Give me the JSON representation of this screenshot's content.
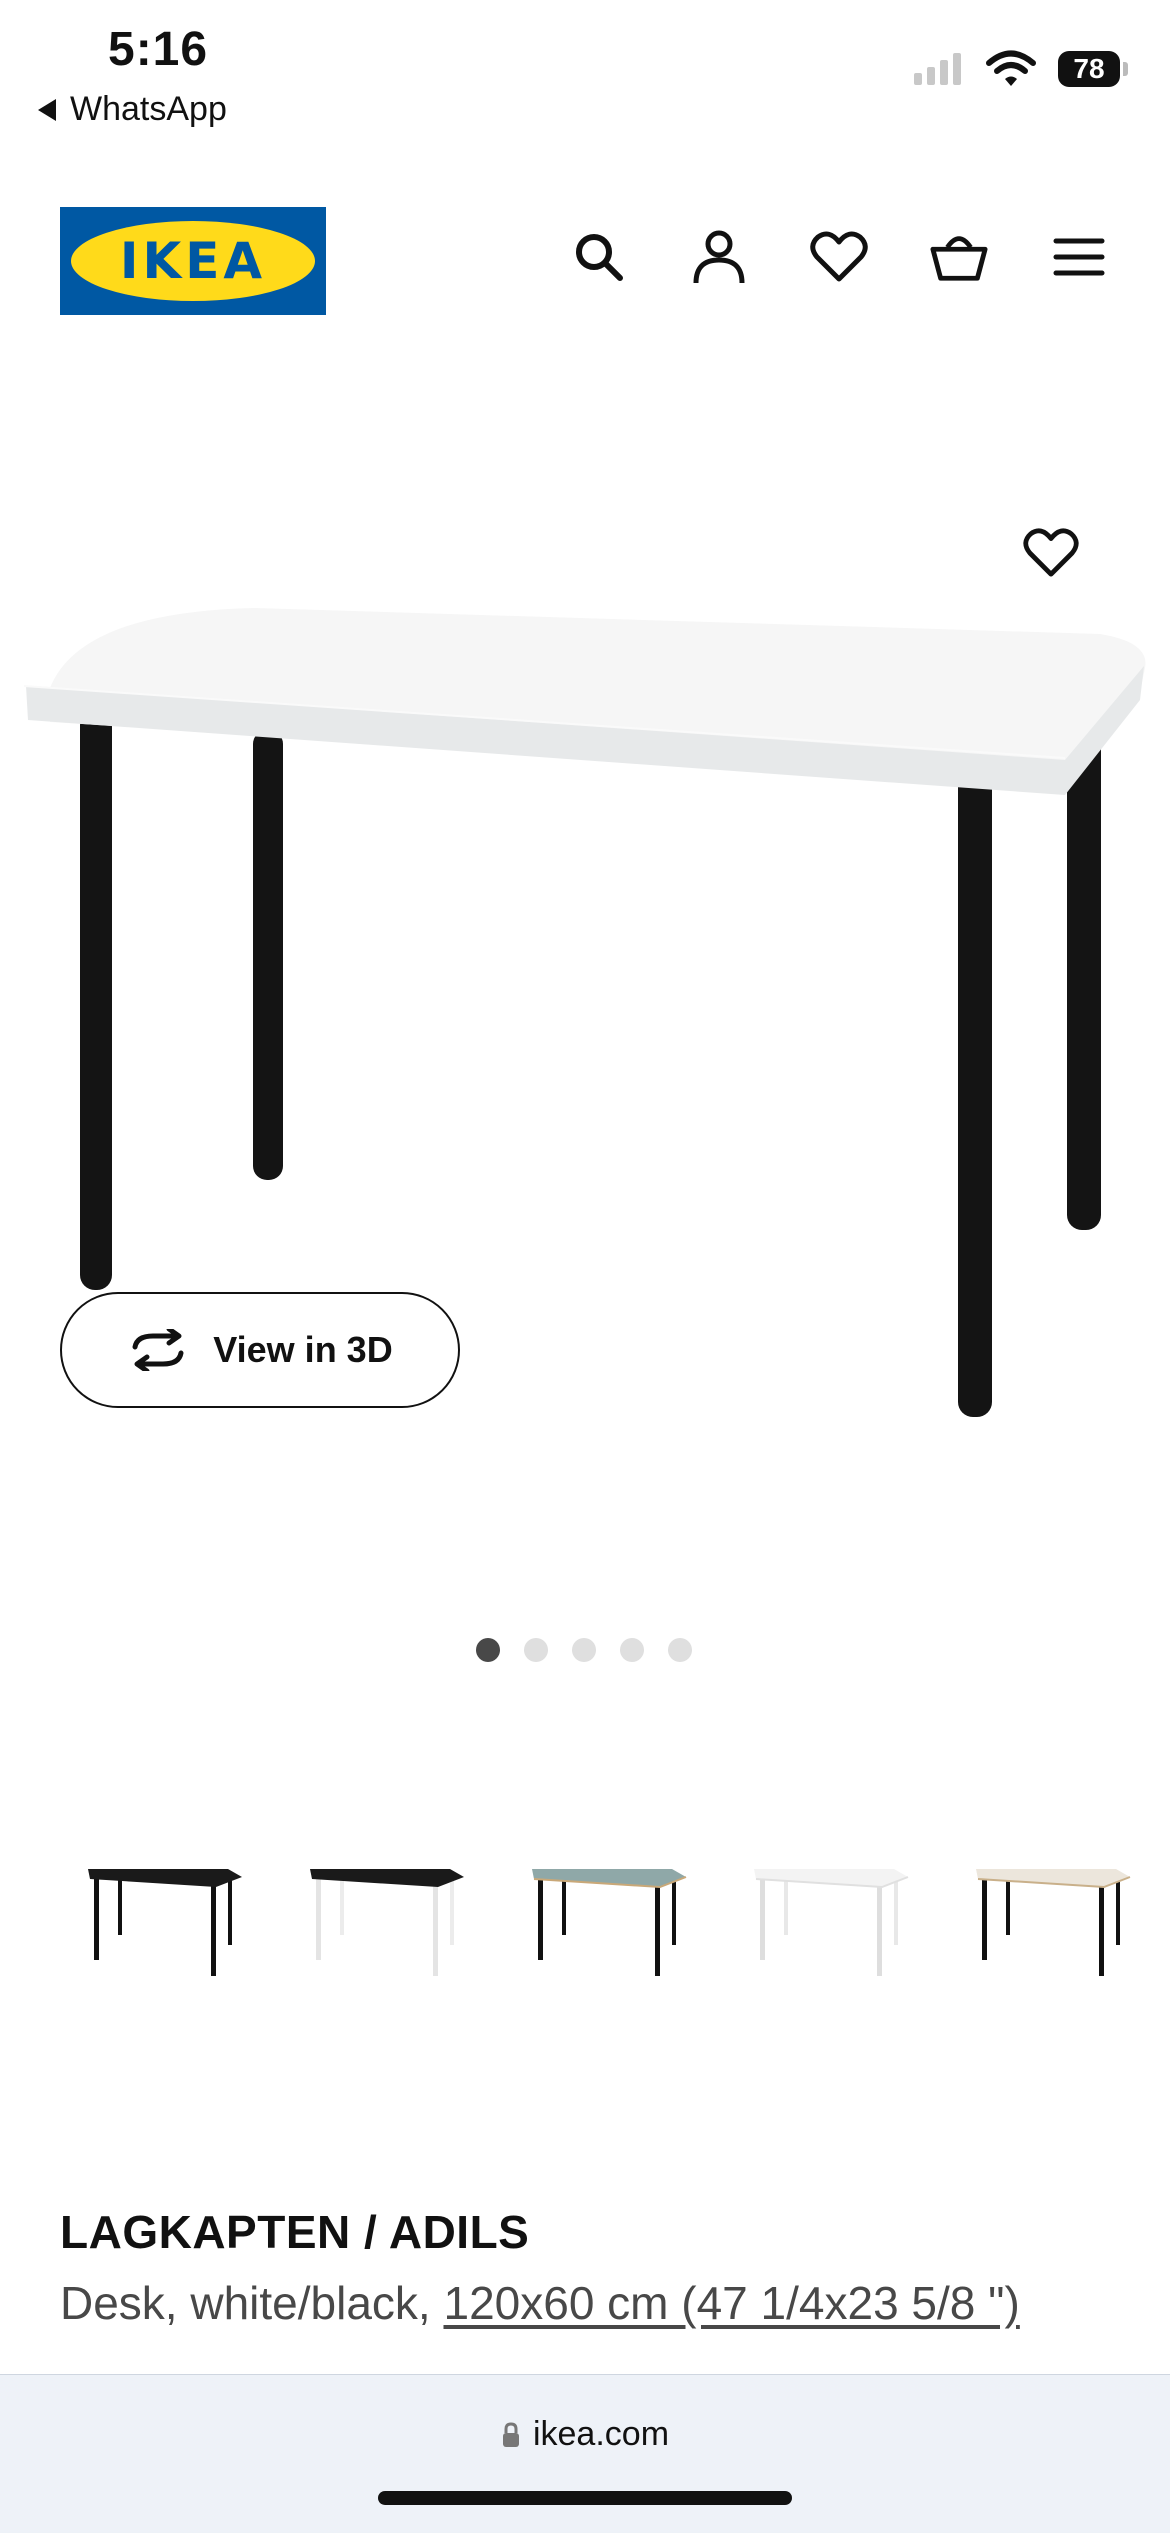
{
  "status_bar": {
    "time": "5:16",
    "back_app": "WhatsApp",
    "battery": "78",
    "icons": [
      "signal-icon",
      "wifi-icon",
      "battery-icon"
    ]
  },
  "header": {
    "logo_text": "IKEA",
    "icons": [
      "search-icon",
      "account-icon",
      "heart-icon",
      "basket-icon",
      "menu-icon"
    ],
    "colors": {
      "brand_blue": "#0058a3",
      "brand_yellow": "#ffda1a"
    }
  },
  "hero": {
    "view3d_label": "View in 3D",
    "carousel_count": 5,
    "carousel_active": 1
  },
  "thumbnails": [
    {
      "top": "#1a1a1a",
      "legs": "#111111"
    },
    {
      "top": "#1a1a1a",
      "legs": "#f0f0f0"
    },
    {
      "top": "#8fa8a8",
      "legs": "#111111"
    },
    {
      "top": "#f3f3f3",
      "legs": "#e6e6e6"
    },
    {
      "top": "#ece6dc",
      "legs": "#111111"
    }
  ],
  "product": {
    "name": "LAGKAPTEN / ADILS",
    "desc_prefix": "Desk, white/black, ",
    "size": "120x60 cm (47 1/4x23 5/8 \")"
  },
  "browser": {
    "url": "ikea.com"
  }
}
